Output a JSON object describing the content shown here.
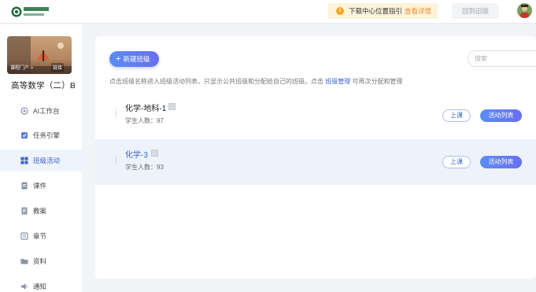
{
  "header": {
    "logo_name": "university-logo",
    "notice_text": "下载中心位置指引",
    "notice_link": "查看详情",
    "old_version_label": "回到旧版",
    "avatar_name": "user-avatar"
  },
  "sidebar": {
    "cover_text_left": "课程门户 >",
    "cover_text_right": "链接",
    "course_title": "高等数学（二）B",
    "items": [
      {
        "label": "AI工作台",
        "icon": "ai-workbench-icon"
      },
      {
        "label": "任务引擎",
        "icon": "task-engine-icon"
      },
      {
        "label": "班级活动",
        "icon": "class-activity-icon",
        "active": true
      },
      {
        "label": "课件",
        "icon": "courseware-icon"
      },
      {
        "label": "教案",
        "icon": "lesson-plan-icon"
      },
      {
        "label": "章节",
        "icon": "chapter-icon"
      },
      {
        "label": "资料",
        "icon": "materials-icon"
      },
      {
        "label": "通知",
        "icon": "notice-icon"
      }
    ]
  },
  "main": {
    "new_class_label": "新建班级",
    "search_placeholder": "搜索",
    "hint_prefix": "点击班级名称进入班级活动列表，只显示公共班级和分配给自己的班级。点击",
    "hint_link": "班级管理",
    "hint_suffix": "可再次分配和管理",
    "classes": [
      {
        "name": "化学-地科-1",
        "count_text": "学生人数：97",
        "class_btn": "上课",
        "activity_btn": "活动列表"
      },
      {
        "name": "化学-3",
        "count_text": "学生人数：93",
        "class_btn": "上课",
        "activity_btn": "活动列表",
        "selected": true
      }
    ]
  },
  "colors": {
    "accent": "#3a63c8",
    "button_gradient_start": "#5b8cf5",
    "button_gradient_end": "#6a6ff0",
    "notice_bg": "#fdf3da",
    "notice_link": "#e8912c",
    "selected_row_bg": "#eef3fb"
  }
}
